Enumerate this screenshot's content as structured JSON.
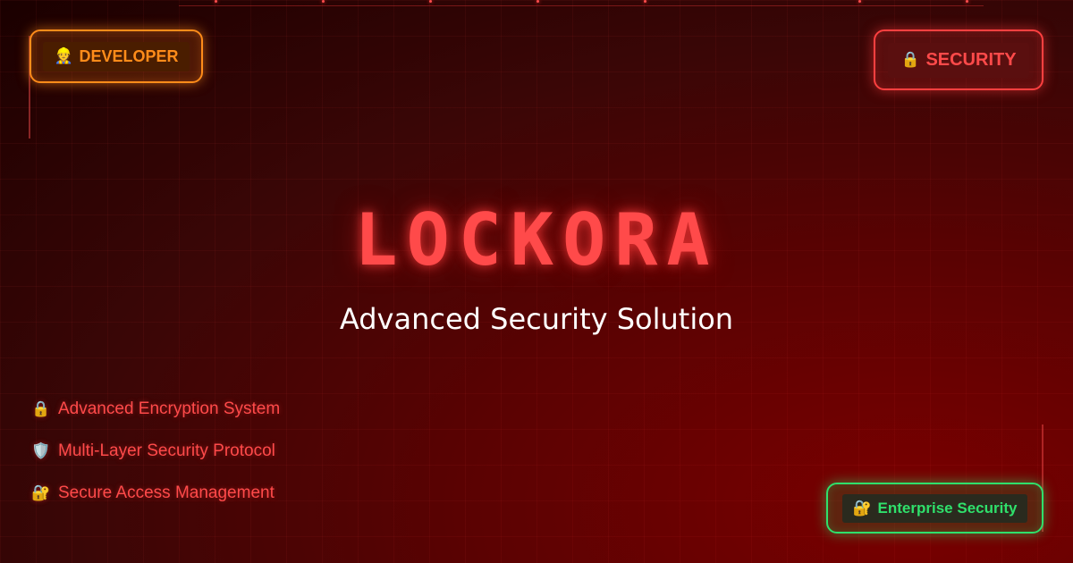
{
  "badges": {
    "developer": {
      "icon": "👷",
      "label": "DEVELOPER"
    },
    "security": {
      "icon": "🔒",
      "label": "SECURITY"
    },
    "enterprise": {
      "icon": "🔐",
      "label": "Enterprise Security"
    }
  },
  "hero": {
    "title": "LOCKORA",
    "subtitle": "Advanced Security Solution"
  },
  "features": [
    {
      "icon": "🔒",
      "label": "Advanced Encryption System"
    },
    {
      "icon": "🛡️",
      "label": "Multi-Layer Security Protocol"
    },
    {
      "icon": "🔐",
      "label": "Secure Access Management"
    }
  ],
  "colors": {
    "developer_accent": "#ff8c1a",
    "security_accent": "#ff4040",
    "enterprise_accent": "#2fe06b",
    "title": "#ff4a4a",
    "subtitle": "#ffffff"
  }
}
